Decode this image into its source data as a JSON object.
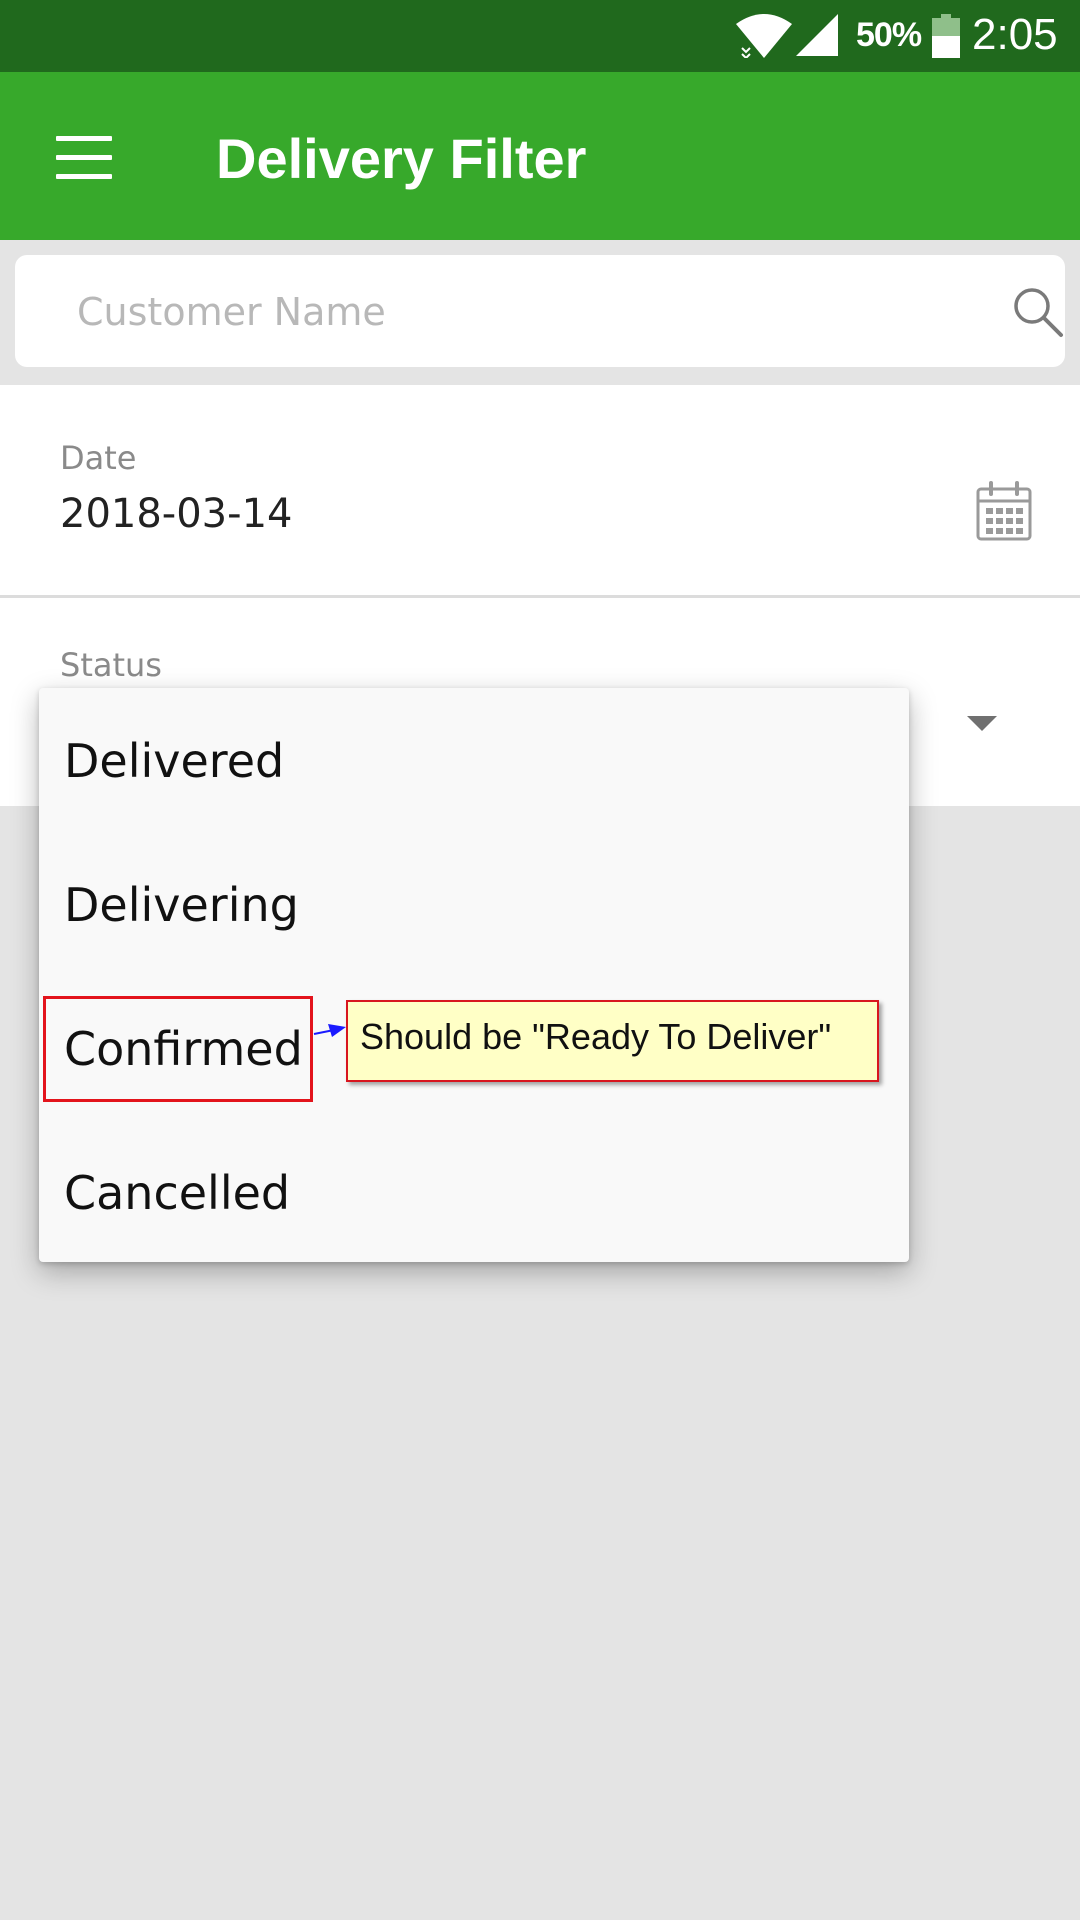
{
  "status_bar": {
    "battery_percent": "50%",
    "time": "2:05",
    "icons": [
      "wifi-icon",
      "signal-icon",
      "battery-icon"
    ]
  },
  "app_bar": {
    "title": "Delivery Filter",
    "menu_icon": "menu-icon",
    "color": "#37a92b"
  },
  "search": {
    "placeholder": "Customer Name",
    "value": "",
    "icon": "search-icon"
  },
  "date_field": {
    "label": "Date",
    "value": "2018-03-14",
    "icon": "calendar-icon"
  },
  "status_field": {
    "label": "Status",
    "icon": "dropdown-arrow-icon",
    "options": [
      "Delivered",
      "Delivering",
      "Confirmed",
      "Cancelled"
    ]
  },
  "annotation": {
    "note": "Should be \"Ready To Deliver\"",
    "target": "Confirmed",
    "box_color": "#e3141c",
    "note_background": "#ffffc6",
    "arrow_color": "#1a1aff"
  }
}
